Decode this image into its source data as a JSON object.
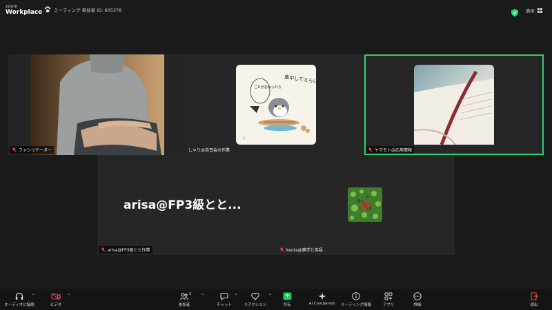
{
  "brand": {
    "zoom": "zoom",
    "product": "Workplace"
  },
  "meeting": {
    "info": "ミーティング 参加者 ID: 605378"
  },
  "view": {
    "label": "表示"
  },
  "tiles": {
    "facilitator": {
      "name": "ファシリテーター"
    },
    "shiri": {
      "name": "しゃり@自習会の作業"
    },
    "yamamoto": {
      "name": "ヤマモト@応用情報"
    },
    "arisa": {
      "name": "arisa@FP3級とと作業",
      "display_name": "arisa@FP3級とと..."
    },
    "kenta": {
      "name": "kenta@薬学と英語"
    }
  },
  "penguin_text": {
    "speech_right": "集中してえらい！",
    "speech_left": "これがおわったら"
  },
  "toolbar": {
    "audio": "オーディオに接続",
    "video": "ビデオ",
    "participants": "参加者",
    "participants_count": "3",
    "chat": "チャット",
    "reactions": "リアクション",
    "share": "共有",
    "ai": "AI Companion",
    "info": "ミーティング情報",
    "apps": "アプリ",
    "more": "詳細",
    "leave": "退出"
  },
  "colors": {
    "accent_green": "#2bd36f",
    "share_green": "#1fc35f",
    "alert_red": "#e5484d"
  }
}
